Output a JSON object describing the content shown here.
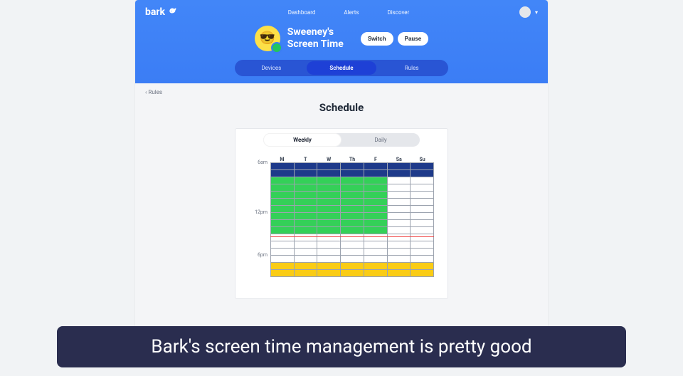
{
  "brand": "bark",
  "nav": {
    "dashboard": "Dashboard",
    "alerts": "Alerts",
    "discover": "Discover"
  },
  "profile": {
    "line1": "Sweeney's",
    "line2": "Screen Time"
  },
  "actions": {
    "switch": "Switch",
    "pause": "Pause"
  },
  "tabs": {
    "devices": "Devices",
    "schedule": "Schedule",
    "rules": "Rules"
  },
  "back_label": "Rules",
  "page_title": "Schedule",
  "toggle": {
    "weekly": "Weekly",
    "daily": "Daily"
  },
  "days": [
    "M",
    "T",
    "W",
    "Th",
    "F",
    "Sa",
    "Su"
  ],
  "time_labels": {
    "t0": "6am",
    "t1": "12pm",
    "t2": "6pm"
  },
  "schedule_rows": [
    [
      "navy",
      "navy",
      "navy",
      "navy",
      "navy",
      "navy",
      "navy"
    ],
    [
      "navy",
      "navy",
      "navy",
      "navy",
      "navy",
      "navy",
      "navy"
    ],
    [
      "green",
      "green",
      "green",
      "green",
      "green",
      "white",
      "white"
    ],
    [
      "green",
      "green",
      "green",
      "green",
      "green",
      "white",
      "white"
    ],
    [
      "green",
      "green",
      "green",
      "green",
      "green",
      "white",
      "white"
    ],
    [
      "green",
      "green",
      "green",
      "green",
      "green",
      "white",
      "white"
    ],
    [
      "green",
      "green",
      "green",
      "green",
      "green",
      "white",
      "white"
    ],
    [
      "green",
      "green",
      "green",
      "green",
      "green",
      "white",
      "white"
    ],
    [
      "green",
      "green",
      "green",
      "green",
      "green",
      "white",
      "white"
    ],
    [
      "green",
      "green",
      "green",
      "green",
      "green",
      "white",
      "white"
    ],
    [
      "white",
      "white",
      "white",
      "white",
      "white",
      "white",
      "white"
    ],
    [
      "white",
      "white",
      "white",
      "white",
      "white",
      "white",
      "white"
    ],
    [
      "white",
      "white",
      "white",
      "white",
      "white",
      "white",
      "white"
    ],
    [
      "white",
      "white",
      "white",
      "white",
      "white",
      "white",
      "white"
    ],
    [
      "yellow",
      "yellow",
      "yellow",
      "yellow",
      "yellow",
      "yellow",
      "yellow"
    ],
    [
      "yellow",
      "yellow",
      "yellow",
      "yellow",
      "yellow",
      "yellow",
      "yellow"
    ]
  ],
  "redline_after_row": 10,
  "caption": "Bark's screen time management is pretty good"
}
